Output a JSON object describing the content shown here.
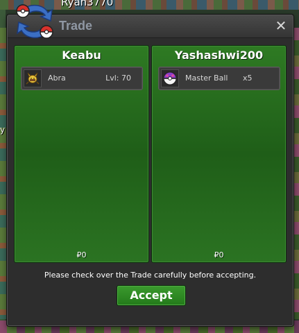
{
  "background": {
    "player_tag": "Ryan3770",
    "side_glyph": "y"
  },
  "window": {
    "title": "Trade",
    "close_glyph": "✕"
  },
  "left_panel": {
    "name": "Keabu",
    "item": {
      "icon": "abra-icon",
      "name": "Abra",
      "level": "Lvl: 70"
    },
    "money": "₽0"
  },
  "right_panel": {
    "name": "Yashashwi200",
    "item": {
      "icon": "master-ball-icon",
      "name": "Master Ball",
      "quantity": "x5"
    },
    "money": "₽0"
  },
  "footer": {
    "notice": "Please check over the Trade carefully before accepting.",
    "accept_label": "Accept"
  },
  "colors": {
    "panel_green": "#2e7a23",
    "accept_green": "#3b9a2e",
    "title_gray": "#8f97a3"
  }
}
